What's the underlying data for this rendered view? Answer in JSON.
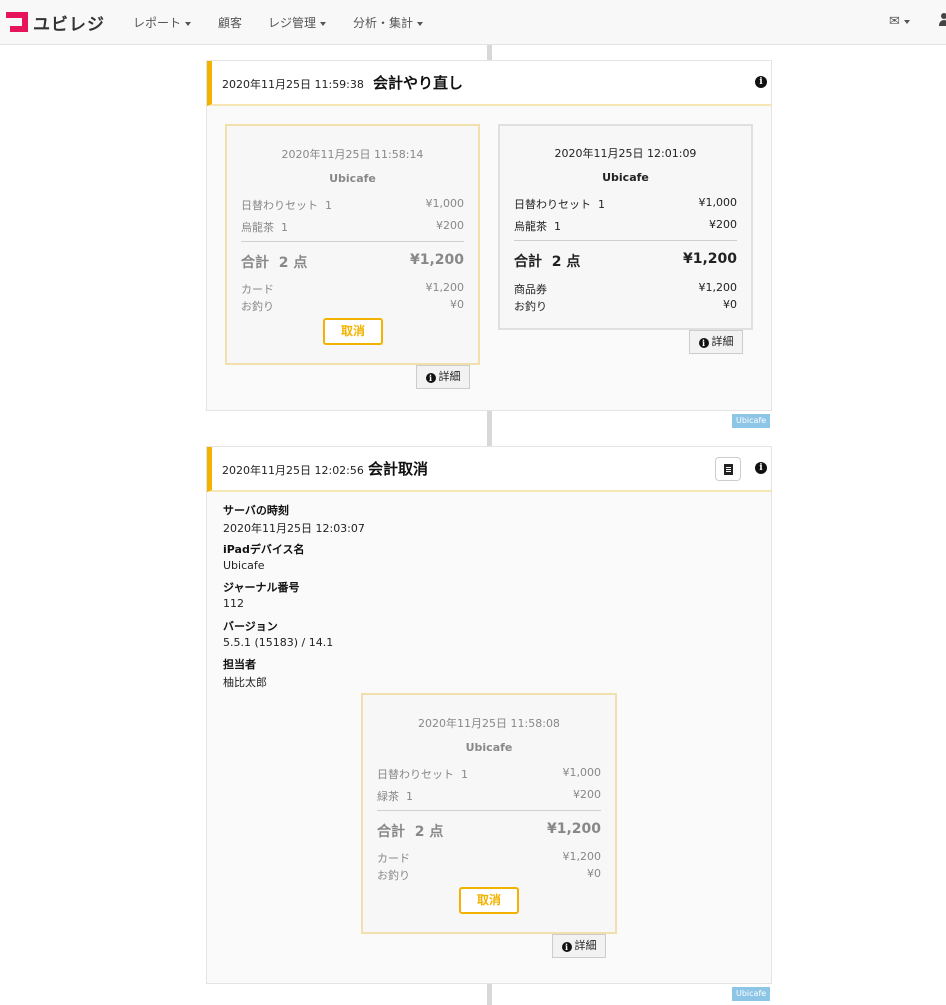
{
  "nav": {
    "logo": "ユビレジ",
    "items": [
      "レポート",
      "顧客",
      "レジ管理",
      "分析・集計"
    ],
    "mail_icon": "✉"
  },
  "events": [
    {
      "time": "2020年11月25日 11:59:38",
      "title": "会計やり直し",
      "receipts": [
        {
          "status": "cancelled",
          "datetime": "2020年11月25日 11:58:14",
          "shop": "Ubicafe",
          "items": [
            {
              "name": "日替わりセット",
              "qty": "1",
              "price": "¥1,000"
            },
            {
              "name": "烏龍茶",
              "qty": "1",
              "price": "¥200"
            }
          ],
          "total_label": "合計",
          "total_count": "2 点",
          "total": "¥1,200",
          "payments": [
            {
              "label": "カード",
              "value": "¥1,200"
            },
            {
              "label": "お釣り",
              "value": "¥0"
            }
          ],
          "cancel_label": "取消",
          "detail_label": "詳細"
        },
        {
          "status": "normal",
          "datetime": "2020年11月25日 12:01:09",
          "shop": "Ubicafe",
          "items": [
            {
              "name": "日替わりセット",
              "qty": "1",
              "price": "¥1,000"
            },
            {
              "name": "烏龍茶",
              "qty": "1",
              "price": "¥200"
            }
          ],
          "total_label": "合計",
          "total_count": "2 点",
          "total": "¥1,200",
          "payments": [
            {
              "label": "商品券",
              "value": "¥1,200"
            },
            {
              "label": "お釣り",
              "value": "¥0"
            }
          ],
          "detail_label": "詳細"
        }
      ],
      "device_tag": "Ubicafe"
    },
    {
      "time": "2020年11月25日 12:02:56",
      "title": "会計取消",
      "meta": [
        {
          "label": "サーバの時刻",
          "value": "2020年11月25日 12:03:07"
        },
        {
          "label": "iPadデバイス名",
          "value": "Ubicafe"
        },
        {
          "label": "ジャーナル番号",
          "value": "112"
        },
        {
          "label": "バージョン",
          "value": "5.5.1 (15183) / 14.1"
        },
        {
          "label": "担当者",
          "value": "柚比太郎"
        }
      ],
      "receipt": {
        "status": "cancelled",
        "datetime": "2020年11月25日 11:58:08",
        "shop": "Ubicafe",
        "items": [
          {
            "name": "日替わりセット",
            "qty": "1",
            "price": "¥1,000"
          },
          {
            "name": "緑茶",
            "qty": "1",
            "price": "¥200"
          }
        ],
        "total_label": "合計",
        "total_count": "2 点",
        "total": "¥1,200",
        "payments": [
          {
            "label": "カード",
            "value": "¥1,200"
          },
          {
            "label": "お釣り",
            "value": "¥0"
          }
        ],
        "cancel_label": "取消",
        "detail_label": "詳細"
      },
      "device_tag": "Ubicafe"
    }
  ]
}
